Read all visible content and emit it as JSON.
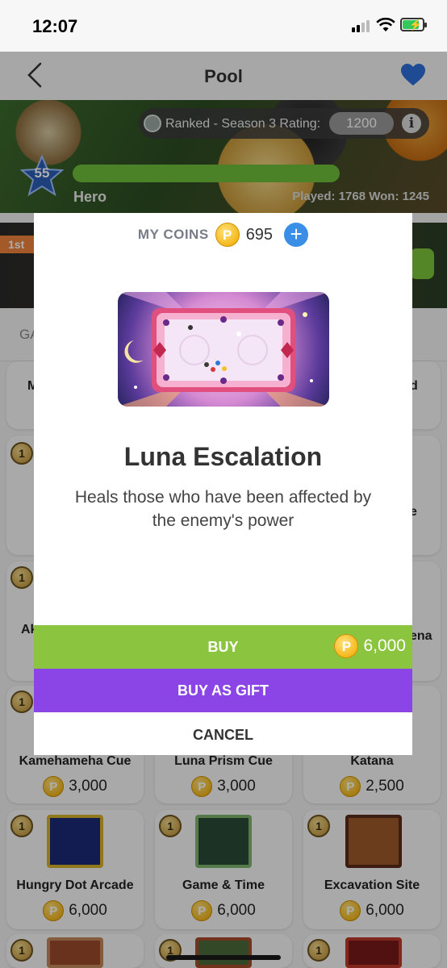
{
  "status_bar": {
    "time": "12:07"
  },
  "nav": {
    "title": "Pool"
  },
  "profile": {
    "rating_label": "Ranked - Season 3 Rating:",
    "rating_value": "1200",
    "info": "i",
    "level": "55",
    "name": "Hero",
    "stats": "Played: 1768 Won: 1245",
    "xp_fraction": 0.99
  },
  "background": {
    "tag_first": "1st",
    "tab_partial": "GA",
    "cards": [
      {
        "badge": "1",
        "name": "Kamehameha Cue",
        "price": "3,000"
      },
      {
        "badge": "1",
        "name": "Luna Prism Cue",
        "price": "3,000"
      },
      {
        "badge": "1",
        "name": "Katana",
        "price": "2,500"
      },
      {
        "badge": "1",
        "name": "Hungry Dot Arcade",
        "price": "6,000"
      },
      {
        "badge": "1",
        "name": "Game & Time",
        "price": "6,000"
      },
      {
        "badge": "1",
        "name": "Excavation Site",
        "price": "6,000"
      }
    ],
    "peek_left": [
      "M",
      "Ak"
    ],
    "peek_right": [
      "d",
      "e",
      "ena"
    ]
  },
  "modal": {
    "coins_label": "MY COINS",
    "coins_value": "695",
    "coin_symbol": "P",
    "plus": "+",
    "item_title": "Luna Escalation",
    "item_description": "Heals those who have been affected by the enemy's power",
    "buy_label": "BUY",
    "buy_price": "6,000",
    "gift_label": "BUY AS GIFT",
    "cancel_label": "CANCEL"
  },
  "colors": {
    "buy": "#8bc53f",
    "gift": "#8b45e6",
    "accent_blue": "#3a8ee6",
    "heart": "#2f6fdc"
  },
  "icons": [
    "back-chevron-icon",
    "heart-icon",
    "rank-shield-icon",
    "info-icon",
    "level-star-icon",
    "coin-icon",
    "plus-icon"
  ]
}
